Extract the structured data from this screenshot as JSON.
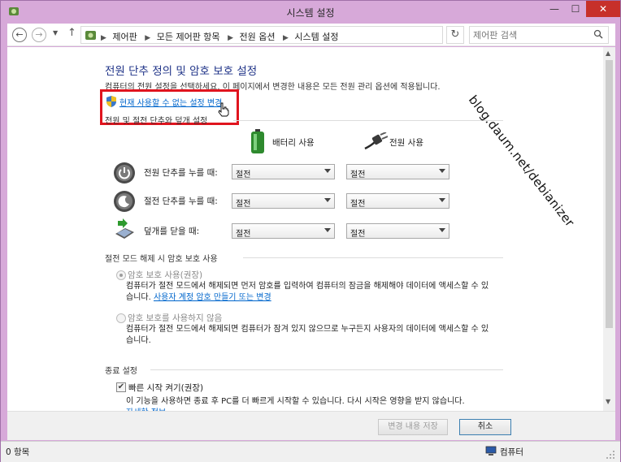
{
  "window": {
    "title": "시스템 설정"
  },
  "nav": {
    "breadcrumbs": [
      "제어판",
      "모든 제어판 항목",
      "전원 옵션",
      "시스템 설정"
    ],
    "search_placeholder": "제어판 검색"
  },
  "page": {
    "heading": "전원 단추 정의 및 암호 보호 설정",
    "subtitle": "컴퓨터의 전원 설정을 선택하세요. 이 페이지에서 변경한 내용은 모든 전원 관리 옵션에 적용됩니다.",
    "change_link": "현재 사용할 수 없는 설정 변경",
    "section_buttons": "전원 및 절전 단추와 덮개 설정",
    "col_battery": "배터리 사용",
    "col_plugged": "전원 사용",
    "rows": [
      {
        "label": "전원 단추를 누를 때:",
        "battery": "절전",
        "plugged": "절전"
      },
      {
        "label": "절전 단추를 누를 때:",
        "battery": "절전",
        "plugged": "절전"
      },
      {
        "label": "덮개를 닫을 때:",
        "battery": "절전",
        "plugged": "절전"
      }
    ],
    "section_password": "절전 모드 해제 시 암호 보호 사용",
    "radio_require": {
      "label": "암호 보호 사용(권장)",
      "desc_before": "컴퓨터가 절전 모드에서 해제되면 먼저 암호를 입력하여 컴퓨터의 잠금을 해제해야 데이터에 액세스할 수 있습니다.",
      "desc_link": "사용자 계정 암호 만들기 또는 변경"
    },
    "radio_none": {
      "label": "암호 보호를 사용하지 않음",
      "desc": "컴퓨터가 절전 모드에서 해제되면 컴퓨터가 잠겨 있지 않으므로 누구든지 사용자의 데이터에 액세스할 수 있습니다."
    },
    "section_shutdown": "종료 설정",
    "fast_startup": {
      "label": "빠른 시작 켜기(권장)",
      "desc": "이 기능을 사용하면 종료 후 PC를 더 빠르게 시작할 수 있습니다. 다시 시작은 영향을 받지 않습니다.",
      "more": "자세한 정보"
    }
  },
  "watermark": "blog.daum.net/debianizer",
  "buttons": {
    "save": "변경 내용 저장",
    "cancel": "취소"
  },
  "status": {
    "items": "0 항목",
    "location": "컴퓨터"
  },
  "colors": {
    "heading": "#1e3287",
    "link": "#0066cc",
    "highlight": "#e0141e",
    "frame": "#d7a9d9"
  }
}
